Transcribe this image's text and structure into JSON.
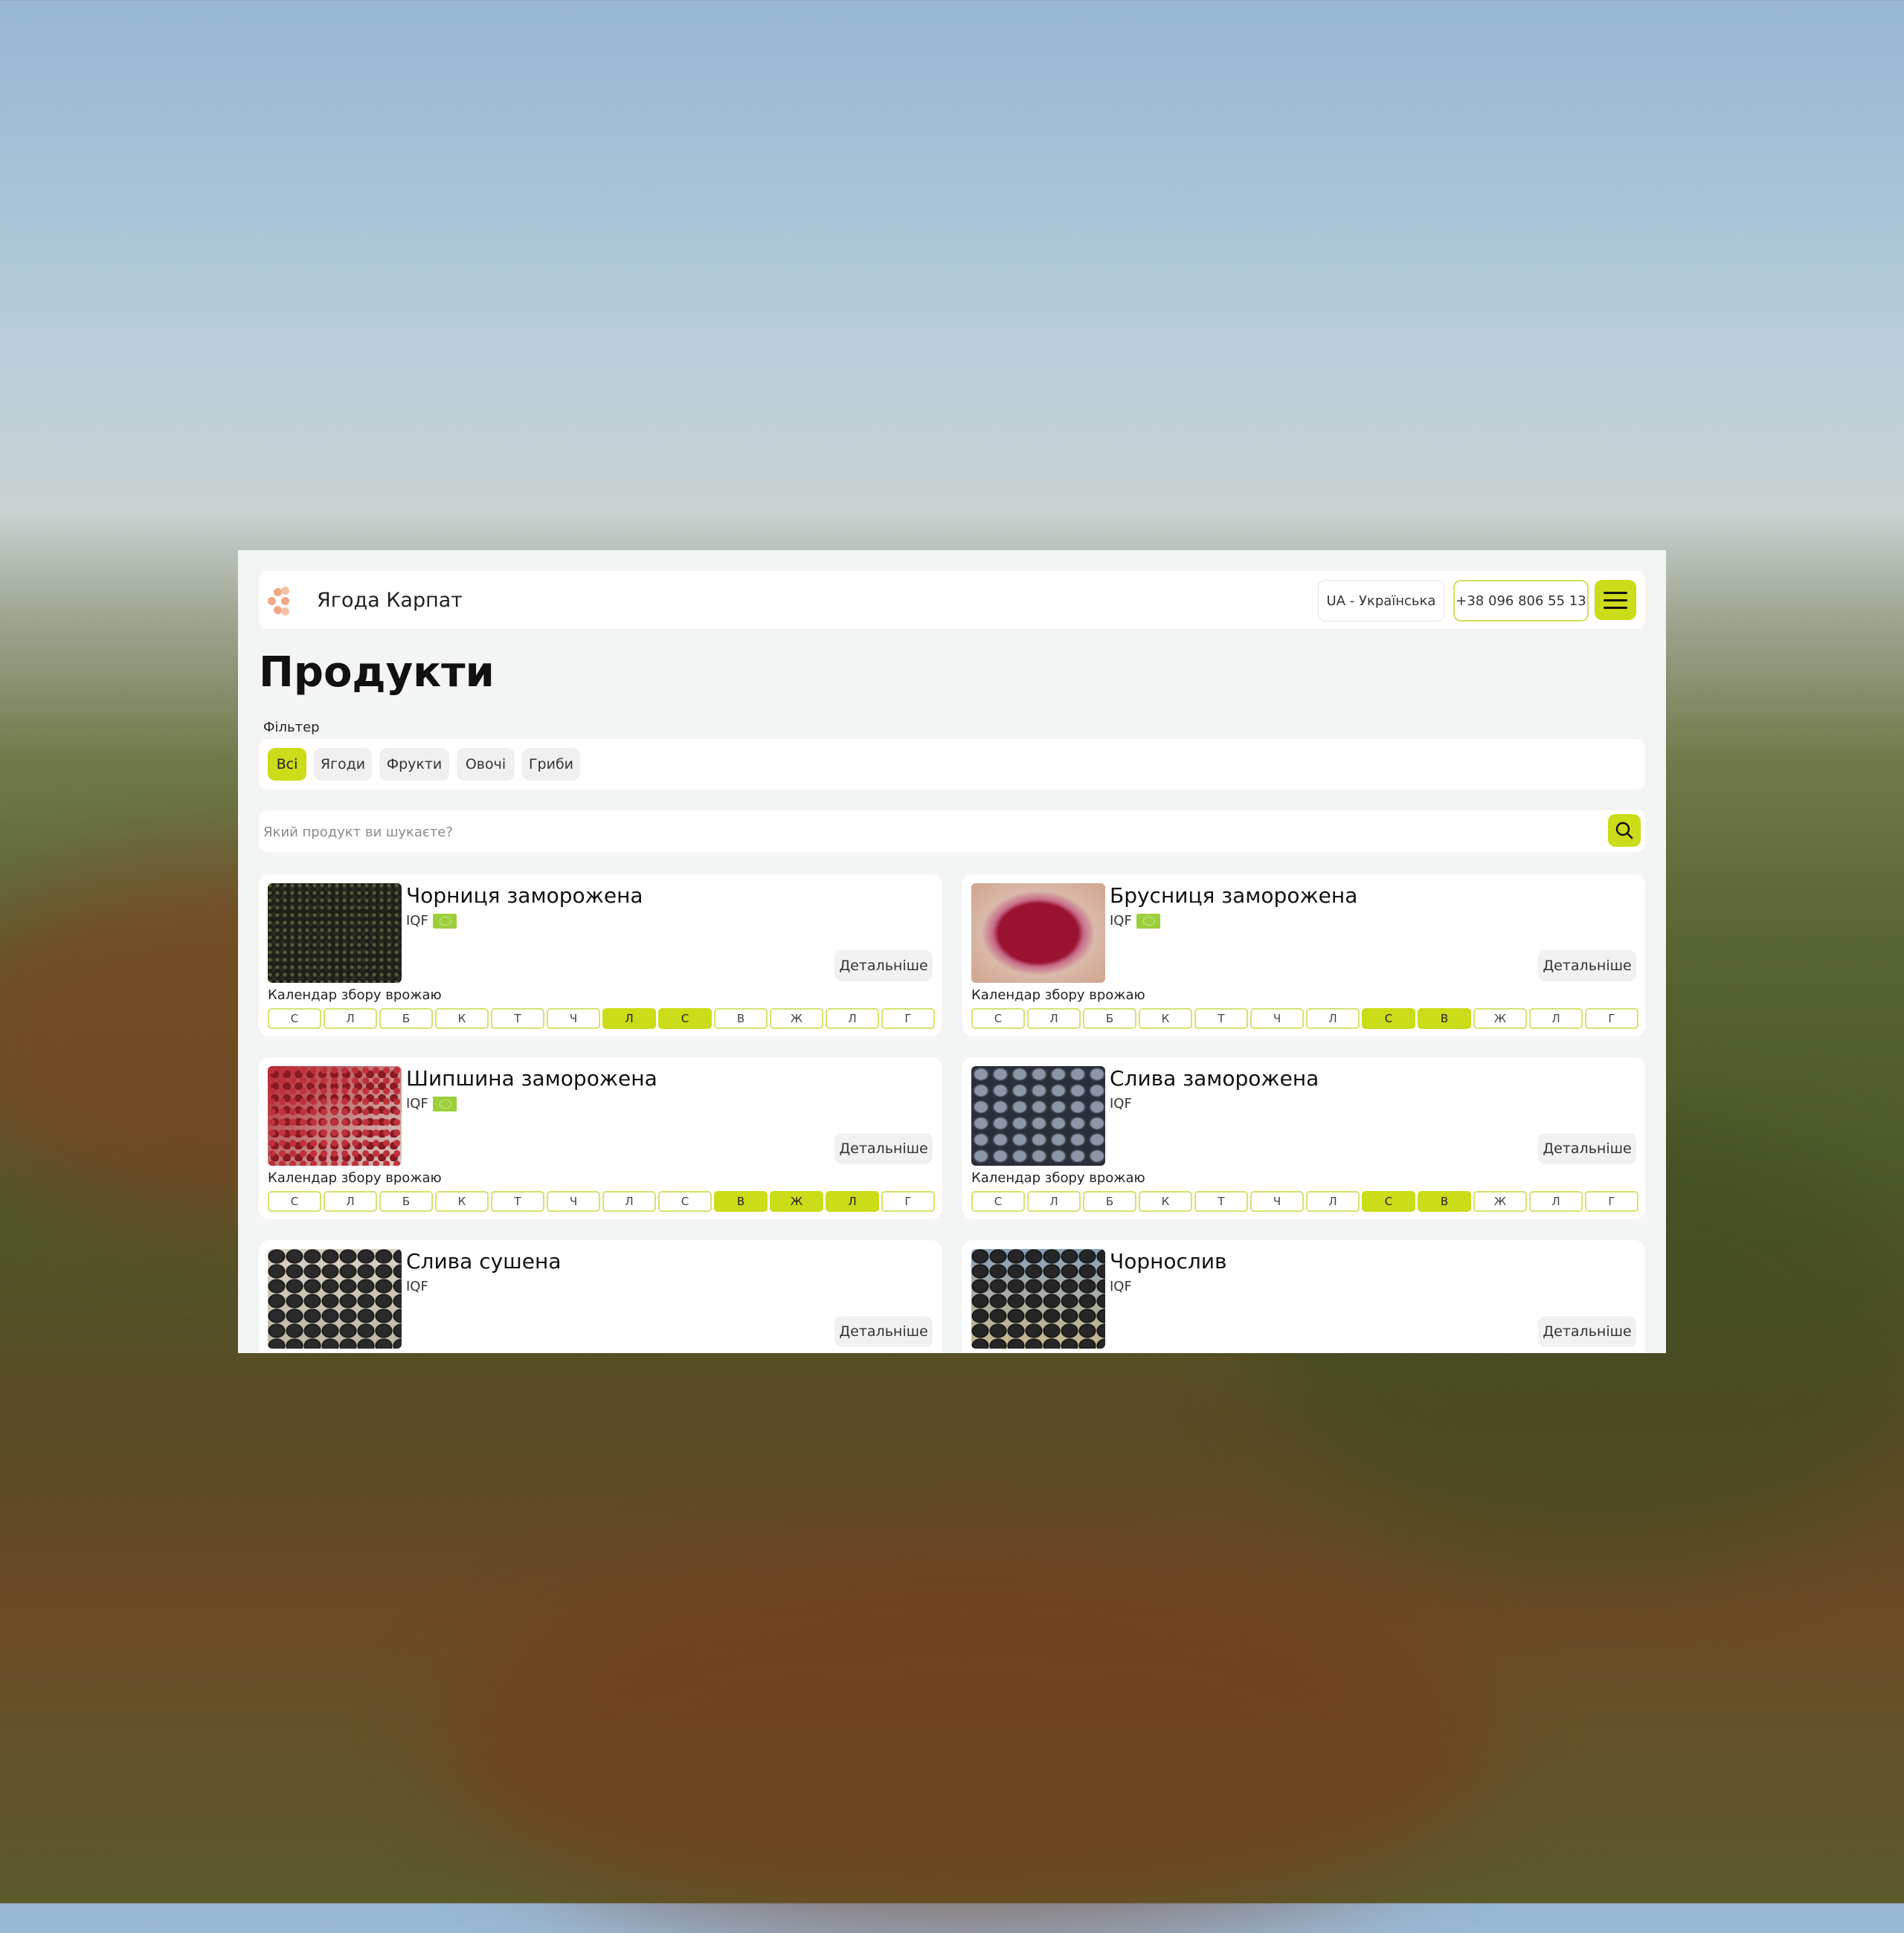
{
  "header": {
    "brand": "Ягода Карпат",
    "language": "UA - Українська",
    "phone": "+38 096 806 55 13"
  },
  "page": {
    "title": "Продукти",
    "filter_label": "Фільтер"
  },
  "filters": [
    {
      "label": "Всі",
      "active": true
    },
    {
      "label": "Ягоди",
      "active": false
    },
    {
      "label": "Фрукти",
      "active": false
    },
    {
      "label": "Овочі",
      "active": false
    },
    {
      "label": "Гриби",
      "active": false
    }
  ],
  "search": {
    "placeholder": "Який продукт ви шукаєте?"
  },
  "calendar_label": "Календар збору врожаю",
  "details_label": "Детальніше",
  "months": [
    "С",
    "Л",
    "Б",
    "К",
    "Т",
    "Ч",
    "Л",
    "С",
    "В",
    "Ж",
    "Л",
    "Г"
  ],
  "colors": {
    "accent": "#cbdc18",
    "month_border": "#d5e36e",
    "eco_badge": "#9ccf3a"
  },
  "products": [
    {
      "name": "Чорниця заморожена",
      "type": "IQF",
      "eco": true,
      "harvest": [
        7,
        8
      ],
      "image": "dark-blueberries"
    },
    {
      "name": "Брусниця заморожена",
      "type": "IQF",
      "eco": true,
      "harvest": [
        8,
        9
      ],
      "image": "red-lingonberries-bag"
    },
    {
      "name": "Шипшина заморожена",
      "type": "IQF",
      "eco": true,
      "harvest": [
        9,
        10,
        11
      ],
      "image": "red-rosehips-bag"
    },
    {
      "name": "Слива заморожена",
      "type": "IQF",
      "eco": false,
      "harvest": [
        8,
        9
      ],
      "image": "frozen-plums"
    },
    {
      "name": "Слива сушена",
      "type": "IQF",
      "eco": false,
      "harvest": [],
      "image": "dried-plums-box"
    },
    {
      "name": "Чорнослив",
      "type": "IQF",
      "eco": false,
      "harvest": [],
      "image": "prunes-box"
    }
  ]
}
